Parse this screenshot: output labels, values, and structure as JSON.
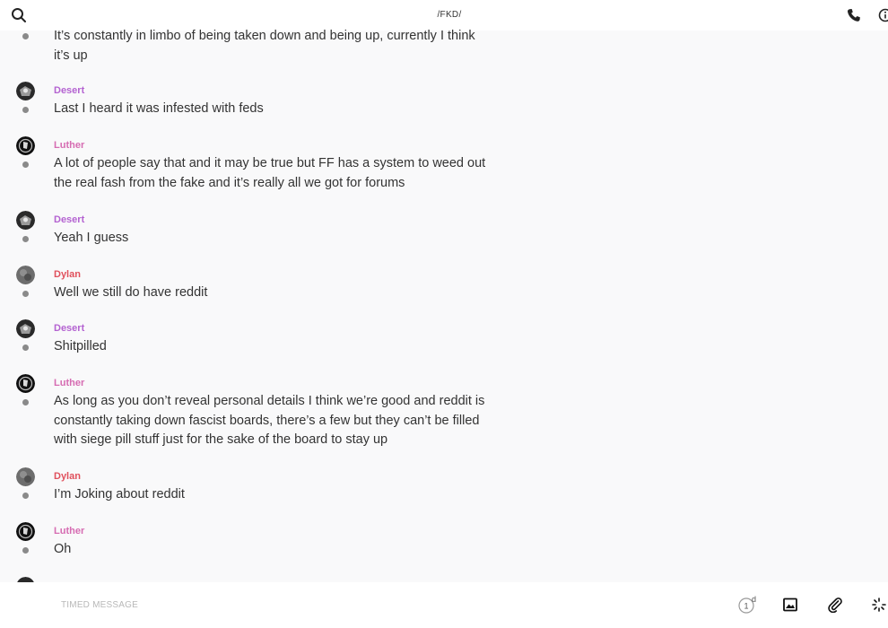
{
  "header": {
    "title": "/FKD/"
  },
  "messages": [
    {
      "name": "",
      "text": "It’s constantly in limbo of being taken down and being up, currently I think it’s up"
    },
    {
      "name": "Desert",
      "text": "Last I heard it was infested with feds"
    },
    {
      "name": "Luther",
      "text": "A lot of people say that and it may be true but FF has a system to weed out the real fash from the fake and it’s really all we got for forums"
    },
    {
      "name": "Desert",
      "text": "Yeah I guess"
    },
    {
      "name": "Dylan",
      "text": "Well we still do have reddit"
    },
    {
      "name": "Desert",
      "text": "Shitpilled"
    },
    {
      "name": "Luther",
      "text": "As long as you don’t reveal personal details I think we’re good and reddit is constantly taking down fascist boards, there’s a few but they can’t be filled with siege pill stuff just for the sake of the board to stay up"
    },
    {
      "name": "Dylan",
      "text": "I’m Joking about reddit"
    },
    {
      "name": "Luther",
      "text": "Oh"
    }
  ],
  "composer": {
    "placeholder": "TIMED MESSAGE",
    "timer_value": "1",
    "timer_unit": "d"
  },
  "colors": {
    "desert": "#b463d1",
    "luther": "#d66cb2",
    "dylan": "#e0515d"
  },
  "icons": {
    "search": "search-icon",
    "phone": "phone-icon",
    "info": "info-icon",
    "timer": "timer-icon",
    "image": "image-icon",
    "attach": "paperclip-icon",
    "more": "spinner-icon"
  }
}
